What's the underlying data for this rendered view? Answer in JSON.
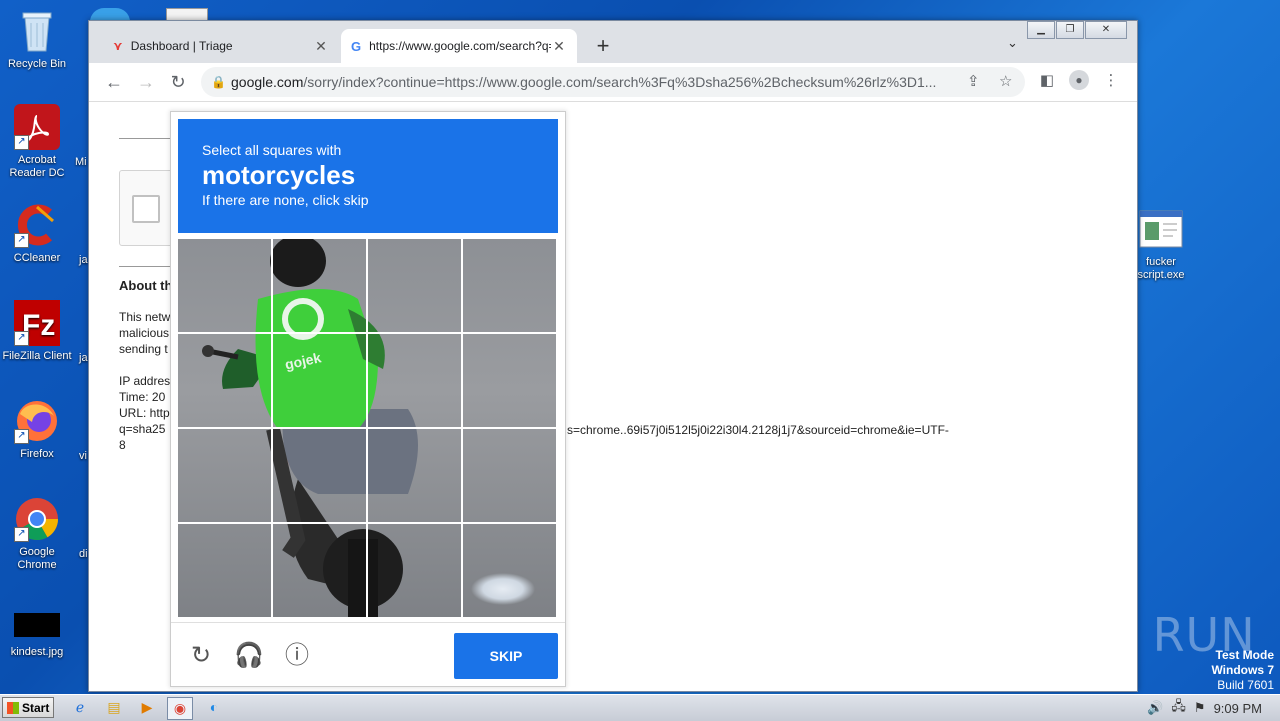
{
  "desktop": {
    "icons": [
      {
        "label": "Recycle Bin"
      },
      {
        "label": "Acrobat Reader DC"
      },
      {
        "label": "CCleaner"
      },
      {
        "label": "FileZilla Client"
      },
      {
        "label": "Firefox"
      },
      {
        "label": "Google Chrome"
      },
      {
        "label": "kindest.jpg"
      },
      {
        "label": "fucker script.exe"
      }
    ],
    "cut_labels": [
      "Mi",
      "ja",
      "ja",
      "vi",
      "di"
    ]
  },
  "browser": {
    "tabs": [
      {
        "title": "Dashboard | Triage",
        "close": "✕"
      },
      {
        "title": "https://www.google.com/search?q=",
        "close": "✕"
      }
    ],
    "new_tab": "+",
    "url_host": "google.com",
    "url_rest": "/sorry/index?continue=https://www.google.com/search%3Fq%3Dsha256%2Bchecksum%26rlz%3D1..."
  },
  "page": {
    "about_heading": "About th",
    "lines_block1": [
      "This netw",
      "malicious",
      "sending t"
    ],
    "lines_block2": [
      "IP addres",
      "Time: 20",
      "URL: http",
      "q=sha25",
      "8"
    ],
    "url_continuation": "s=chrome..69i57j0i512l5j0i22i30l4.2128j1j7&sourceid=chrome&ie=UTF-"
  },
  "captcha": {
    "instruction_line1": "Select all squares with",
    "target": "motorcycles",
    "instruction_line3": "If there are none, click skip",
    "vest_text": "gojek",
    "skip_label": "SKIP",
    "rows": 4,
    "cols": 4
  },
  "watermark": "ANY RUN",
  "test_mode": {
    "line1": "Test Mode",
    "line2": "Windows 7",
    "line3": "Build 7601"
  },
  "taskbar": {
    "start_label": "Start",
    "clock": "9:09 PM"
  },
  "colors": {
    "captcha_blue": "#1a73e8",
    "desktop_blue": "#1160c8"
  }
}
